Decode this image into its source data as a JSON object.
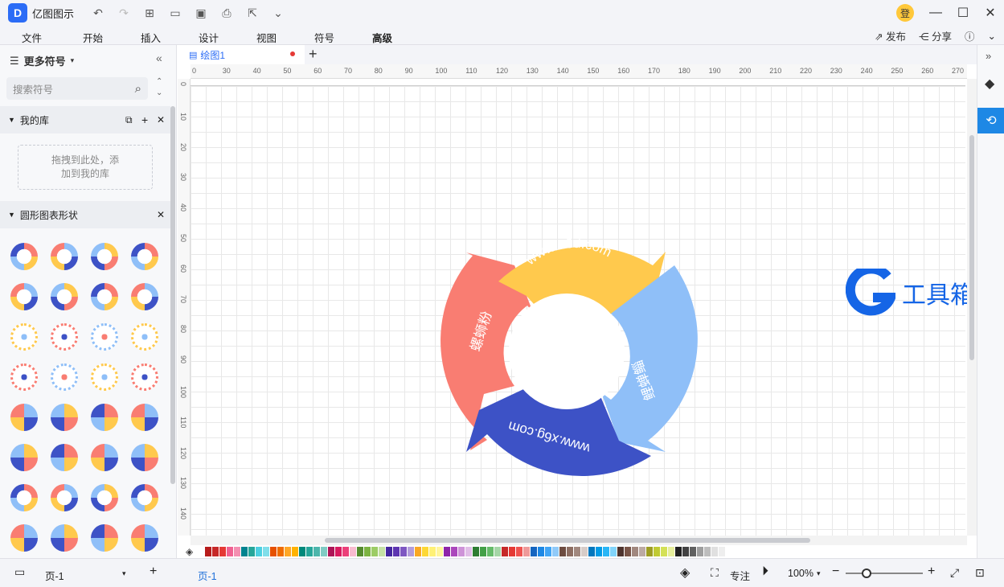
{
  "app": {
    "title": "亿图图示",
    "user_badge": "登"
  },
  "menu": [
    "文件",
    "开始",
    "插入",
    "设计",
    "视图",
    "符号",
    "高级"
  ],
  "menu_right": {
    "publish": "发布",
    "share": "分享"
  },
  "sidebar": {
    "header": "更多符号",
    "search_placeholder": "搜索符号",
    "my_lib": "我的库",
    "drop_hint_1": "拖拽到此处，添",
    "drop_hint_2": "加到我的库",
    "section": "圆形图表形状"
  },
  "tab": {
    "name": "绘图1"
  },
  "ruler_h": [
    "0",
    "30",
    "40",
    "50",
    "60",
    "70",
    "80",
    "90",
    "100",
    "110",
    "120",
    "130",
    "140",
    "150",
    "160",
    "170",
    "180",
    "190",
    "200",
    "210",
    "220",
    "230",
    "240",
    "250",
    "260",
    "270"
  ],
  "ruler_v": [
    "0",
    "10",
    "20",
    "30",
    "40",
    "50",
    "60",
    "70",
    "80",
    "90",
    "100",
    "110",
    "120",
    "130",
    "140"
  ],
  "diagram": {
    "label_top": "www.x6d.com",
    "label_right": "鲤蝉鲻",
    "label_bottom": "www.x6g.com",
    "label_left": "螺蛳粉",
    "colors": {
      "top": "#ffc94d",
      "right": "#8fbff8",
      "bottom": "#3d52c6",
      "left": "#f97d72"
    }
  },
  "watermark": {
    "text": "工具箱",
    "color": "#1565e6"
  },
  "status": {
    "page_select": "页-1",
    "page_tab": "页-1",
    "focus": "专注",
    "zoom": "100%"
  }
}
